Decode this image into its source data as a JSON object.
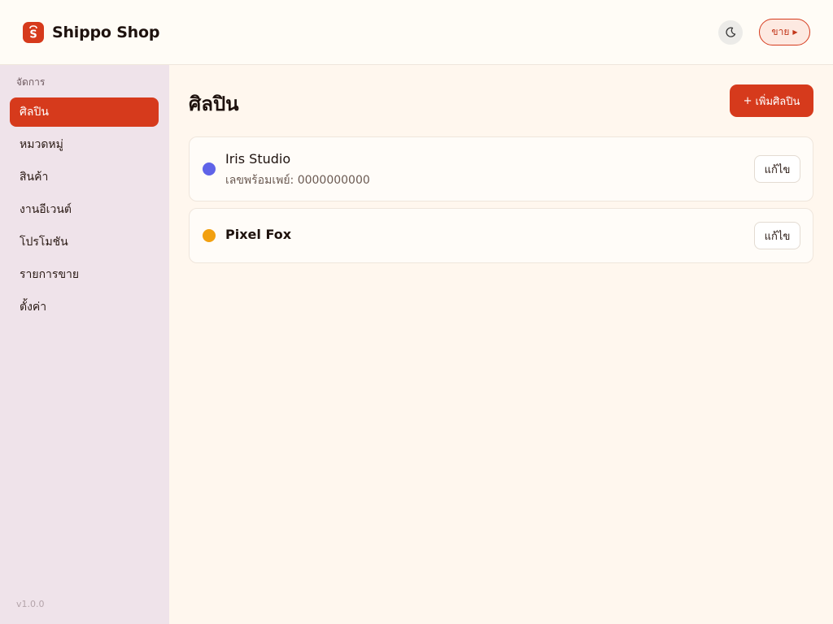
{
  "app": {
    "brand_name": "Shippo Shop",
    "logo_icon": "shopping-bag-s-logo",
    "theme_toggle_icon": "moon-icon",
    "sell_button_label": "ขาย",
    "sell_button_icon": "play-triangle-icon"
  },
  "sidebar": {
    "section_label": "จัดการ",
    "items": [
      {
        "label": "ศิลปิน",
        "active": true
      },
      {
        "label": "หมวดหมู่",
        "active": false
      },
      {
        "label": "สินค้า",
        "active": false
      },
      {
        "label": "งานอีเวนต์",
        "active": false
      },
      {
        "label": "โปรโมชัน",
        "active": false
      },
      {
        "label": "รายการขาย",
        "active": false
      },
      {
        "label": "ตั้งค่า",
        "active": false
      }
    ],
    "version": "v1.0.0"
  },
  "main": {
    "title": "ศิลปิน",
    "add_button_label": "เพิ่มศิลปิน",
    "add_button_icon": "+",
    "artists": [
      {
        "name": "Iris Studio",
        "subtitle": "เลขพร้อมเพย์: 0000000000",
        "color": "#5f63e8",
        "edit_label": "แก้ไข"
      },
      {
        "name": "Pixel Fox",
        "subtitle": "",
        "color": "#f2a010",
        "edit_label": "แก้ไข"
      }
    ]
  },
  "colors": {
    "accent": "#d63a1c",
    "sidebar_bg": "#efe3ea",
    "content_bg": "#fff7ee"
  }
}
